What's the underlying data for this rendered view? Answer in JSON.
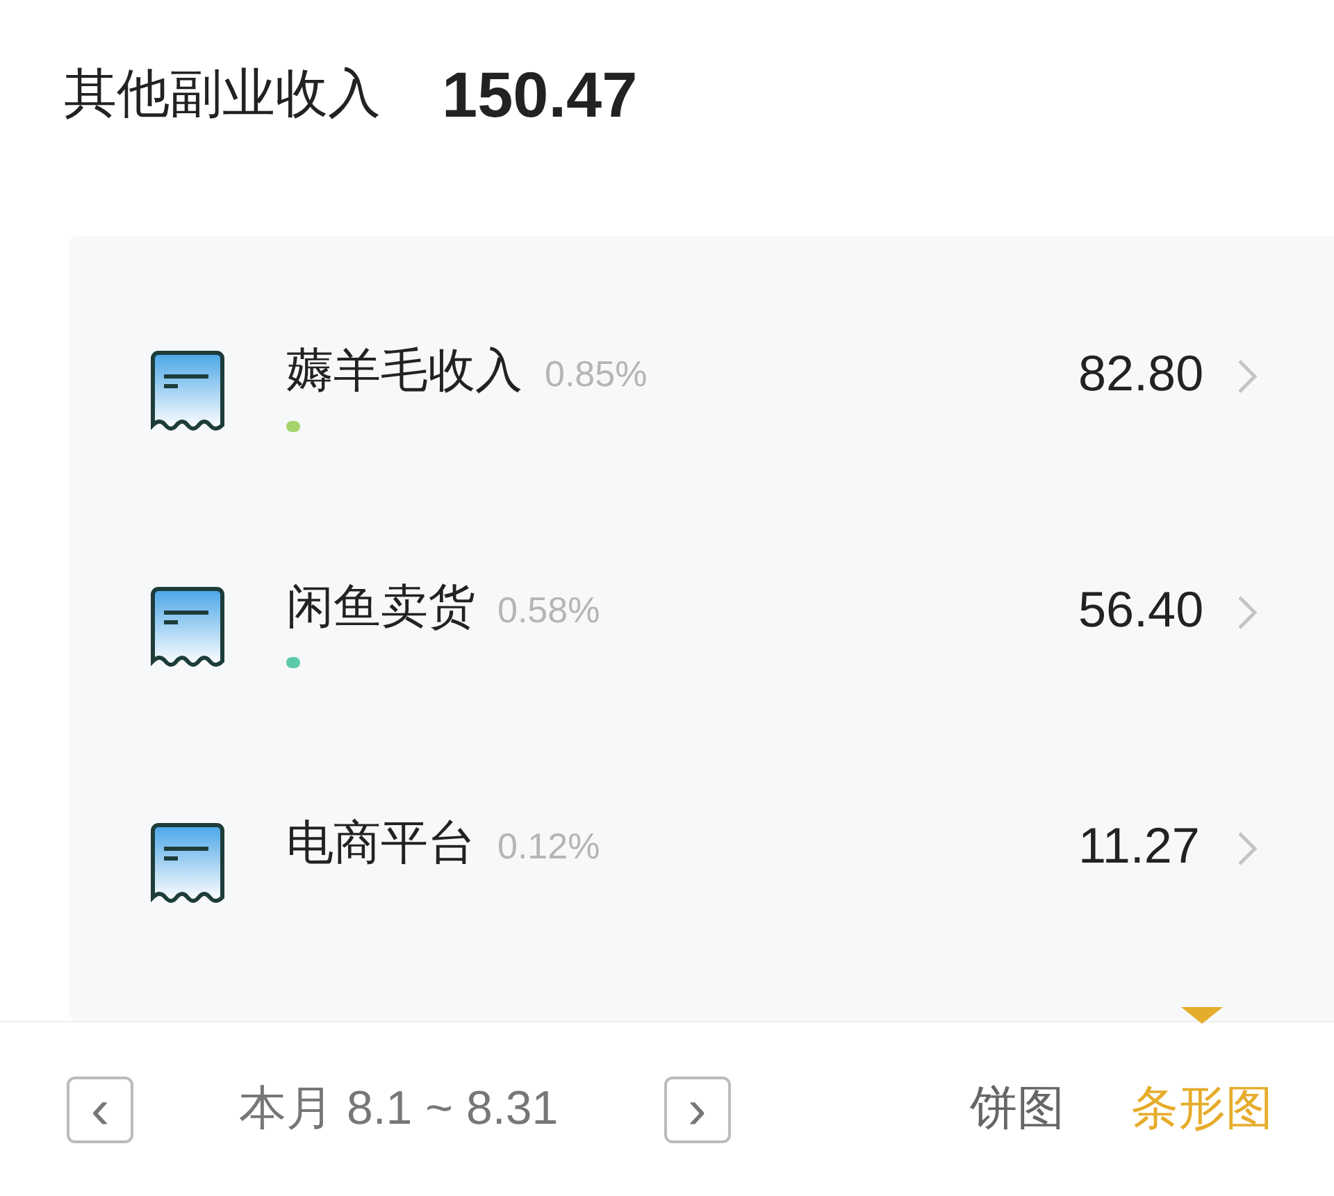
{
  "header": {
    "title": "其他副业收入",
    "total": "150.47"
  },
  "items": [
    {
      "name": "薅羊毛收入",
      "percent": "0.85%",
      "amount": "82.80",
      "bar": {
        "color": "#a6d46c"
      }
    },
    {
      "name": "闲鱼卖货",
      "percent": "0.58%",
      "amount": "56.40",
      "bar": {
        "color": "#5cc9a7"
      }
    },
    {
      "name": "电商平台",
      "percent": "0.12%",
      "amount": "11.27"
    }
  ],
  "footer": {
    "prev": "‹",
    "period": "本月 8.1 ~ 8.31",
    "next": "›",
    "views": [
      {
        "label": "饼图",
        "selected": false
      },
      {
        "label": "条形图",
        "selected": true
      }
    ]
  }
}
